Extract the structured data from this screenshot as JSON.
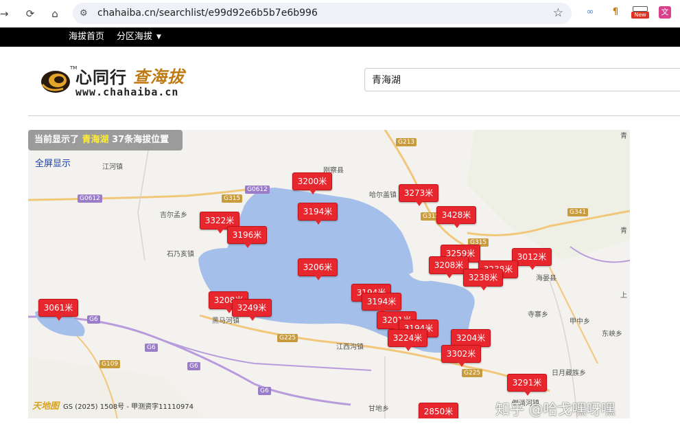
{
  "browser": {
    "url": "chahaiba.cn/searchlist/e99d92e6b5b7e6b996",
    "extensions": {
      "new_badge": "New"
    }
  },
  "topbar": {
    "home_link": "海拔首页",
    "regions_link": "分区海拔"
  },
  "logo": {
    "brand_cn": "心同行",
    "site_cn": "查海拔",
    "site_url": "www.chahaiba.cn",
    "tm": "TM"
  },
  "search": {
    "value": "青海湖"
  },
  "map": {
    "info_prefix": "当前显示了",
    "info_query": "青海湖",
    "info_suffix": "37条海拔位置",
    "fullscreen": "全屏显示",
    "attribution_brand": "天地图",
    "attribution": "GS (2025) 1508号 - 甲测资字11110974",
    "water_color": "#a4bfe9",
    "marker_color": "#e8262e",
    "places": [
      "江河镇",
      "刚察县",
      "哈尔盖镇",
      "吉尔孟乡",
      "石乃亥镇",
      "黑马河镇",
      "江西沟镇",
      "海晏县",
      "寺寨乡",
      "甲中乡",
      "东峡乡",
      "日月藏族乡",
      "甘地乡",
      "倒淌河镇",
      "青",
      "青",
      "上"
    ],
    "roads": [
      "G213",
      "G0612",
      "G0612",
      "G315",
      "G315",
      "G315",
      "G341",
      "G6",
      "G6",
      "G6",
      "G6",
      "G225",
      "G225",
      "G109"
    ],
    "markers": [
      "3200米",
      "3273米",
      "3194米",
      "3322米",
      "3428米",
      "3196米",
      "3259米",
      "3208米",
      "3012米",
      "3236米",
      "3238米",
      "3206米",
      "3061米",
      "3208米",
      "3249米",
      "3194米",
      "3194米",
      "3201米",
      "3194米",
      "3224米",
      "3204米",
      "3302米",
      "3291米",
      "2850米"
    ]
  },
  "watermark": "知乎 @哈戈嘿呀嘿"
}
